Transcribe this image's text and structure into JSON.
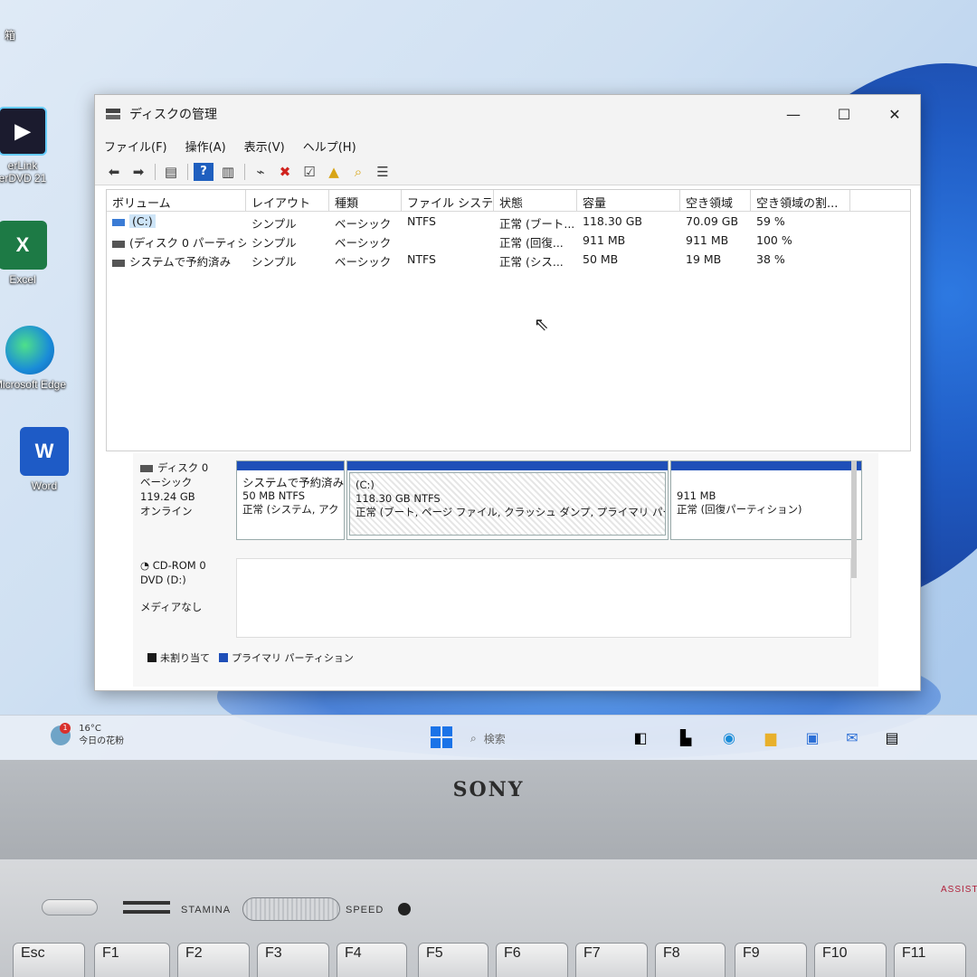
{
  "desktop": {
    "icons": [
      {
        "label": "箱"
      },
      {
        "label": "erLink"
      },
      {
        "label": "erDVD 21"
      },
      {
        "label": "Excel",
        "glyph": "X"
      },
      {
        "label": "Microsoft Edge"
      },
      {
        "label": "Word",
        "glyph": "W"
      }
    ]
  },
  "window": {
    "title": "ディスクの管理",
    "controls": {
      "minimize": "—",
      "maximize": "☐",
      "close": "✕"
    },
    "menu": [
      "ファイル(F)",
      "操作(A)",
      "表示(V)",
      "ヘルプ(H)"
    ],
    "toolbar_icons": [
      "back-arrow-icon",
      "forward-arrow-icon",
      "properties-icon",
      "help-icon",
      "list-view-icon",
      "connect-icon",
      "delete-icon",
      "check-icon",
      "folder-up-icon",
      "search-folder-icon",
      "details-icon"
    ]
  },
  "volumes": {
    "columns": [
      "ボリューム",
      "レイアウト",
      "種類",
      "ファイル システム",
      "状態",
      "容量",
      "空き領域",
      "空き領域の割..."
    ],
    "rows": [
      [
        "(C:)",
        "シンプル",
        "ベーシック",
        "NTFS",
        "正常 (ブート...",
        "118.30 GB",
        "70.09 GB",
        "59 %"
      ],
      [
        "(ディスク 0 パーティシ...",
        "シンプル",
        "ベーシック",
        "",
        "正常 (回復...",
        "911 MB",
        "911 MB",
        "100 %"
      ],
      [
        "システムで予約済み",
        "シンプル",
        "ベーシック",
        "NTFS",
        "正常 (シス...",
        "50 MB",
        "19 MB",
        "38 %"
      ]
    ]
  },
  "disks": [
    {
      "name": "ディスク 0",
      "type": "ベーシック",
      "size": "119.24 GB",
      "status": "オンライン",
      "partitions": [
        {
          "name": "システムで予約済み",
          "size": "50 MB NTFS",
          "status": "正常 (システム, アク"
        },
        {
          "name": "(C:)",
          "size": "118.30 GB NTFS",
          "status": "正常 (ブート, ページ ファイル, クラッシュ ダンプ, プライマリ パーティショ"
        },
        {
          "name": "",
          "size": "911 MB",
          "status": "正常 (回復パーティション)"
        }
      ]
    },
    {
      "name": "CD-ROM 0",
      "type": "DVD (D:)",
      "status": "メディアなし"
    }
  ],
  "legend": [
    {
      "label": "未割り当て",
      "color": "#1a1a1a"
    },
    {
      "label": "プライマリ パーティション",
      "color": "#1f4fb8"
    }
  ],
  "taskbar": {
    "weather_temp": "16°C",
    "weather_desc": "今日の花粉",
    "weather_badge": "1",
    "search_placeholder": "検索"
  },
  "laptop": {
    "brand": "SONY",
    "stamina": "STAMINA",
    "speed": "SPEED",
    "assist": "ASSIST",
    "keys": [
      "Esc",
      "F1",
      "F2",
      "F3",
      "F4",
      "F5",
      "F6",
      "F7",
      "F8",
      "F9",
      "F10",
      "F11"
    ]
  }
}
